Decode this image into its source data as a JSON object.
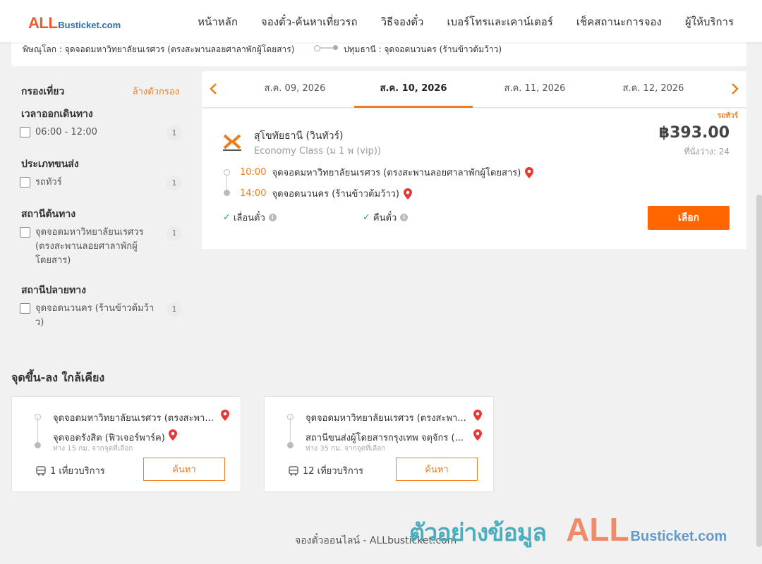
{
  "header": {
    "logo_all": "ALL",
    "logo_rest": "Busticket.com",
    "nav": [
      "หน้าหลัก",
      "จองตั๋ว-ค้นหาเที่ยวรถ",
      "วิธีจองตั๋ว",
      "เบอร์โทรและเคาน์เตอร์",
      "เช็คสถานะการจอง",
      "ผู้ให้บริการ"
    ]
  },
  "route": {
    "from": "พิษณุโลก : จุดจอดมหาวิทยาลัยนเรศวร (ตรงสะพานลอยศาลาพักผู้โดยสาร)",
    "to": "ปทุมธานี : จุดจอดนวนคร (ร้านข้าวต้มว้าว)"
  },
  "filter": {
    "title": "กรองเที่ยว",
    "clear": "ล้างตัวกรอง",
    "groups": [
      {
        "title": "เวลาออกเดินทาง",
        "option": "06:00 - 12:00",
        "count": "1"
      },
      {
        "title": "ประเภทขนส่ง",
        "option": "รถทัวร์",
        "count": "1"
      },
      {
        "title": "สถานีต้นทาง",
        "option": "จุดจอดมหาวิทยาลัยนเรศวร (ตรงสะพานลอยศาลาพักผู้โดยสาร)",
        "count": "1"
      },
      {
        "title": "สถานีปลายทาง",
        "option": "จุดจอดนวนคร (ร้านข้าวต้มว้าว)",
        "count": "1"
      }
    ]
  },
  "dates": [
    "ส.ค. 09, 2026",
    "ส.ค. 10, 2026",
    "ส.ค. 11, 2026",
    "ส.ค. 12, 2026"
  ],
  "trip": {
    "type_tag": "รถทัวร์",
    "operator": "สุโขทัยธานี (วินทัวร์)",
    "class": "Economy Class (ม 1 พ (vip))",
    "price": "฿393.00",
    "seats": "ที่นั่งว่าง: 24",
    "depart_time": "10:00",
    "depart_stop": "จุดจอดมหาวิทยาลัยนเรศวร (ตรงสะพานลอยศาลาพักผู้โดยสาร)",
    "arrive_time": "14:00",
    "arrive_stop": "จุดจอดนวนคร (ร้านข้าวต้มว้าว)",
    "feature1": "เลื่อนตั๋ว",
    "feature2": "คืนตั๋ว",
    "select_label": "เลือก",
    "accent": "#ff6600"
  },
  "nearby": {
    "title": "จุดขึ้น-ลง ใกล้เคียง",
    "cards": [
      {
        "from": "จุดจอดมหาวิทยาลัยนเรศวร (ตรงสะพา...",
        "to": "จุดจอดรังสิต (ฟิวเจอร์พาร์ค)",
        "dist": "ห่าง 15 กม. จากจุดที่เลือก",
        "trips": "1 เที่ยวบริการ",
        "button": "ค้นหา"
      },
      {
        "from": "จุดจอดมหาวิทยาลัยนเรศวร (ตรงสะพา...",
        "to": "สถานีขนส่งผู้โดยสารกรุงเทพ จตุจักร (...",
        "dist": "ห่าง 35 กม. จากจุดที่เลือก",
        "trips": "12 เที่ยวบริการ",
        "button": "ค้นหา"
      }
    ]
  },
  "footer": "จองตั๋วออนไลน์ - ALLbusticket.com",
  "watermark": {
    "text": "ตัวอย่างข้อมูล",
    "all": "ALL",
    "rest": "Busticket.com"
  }
}
